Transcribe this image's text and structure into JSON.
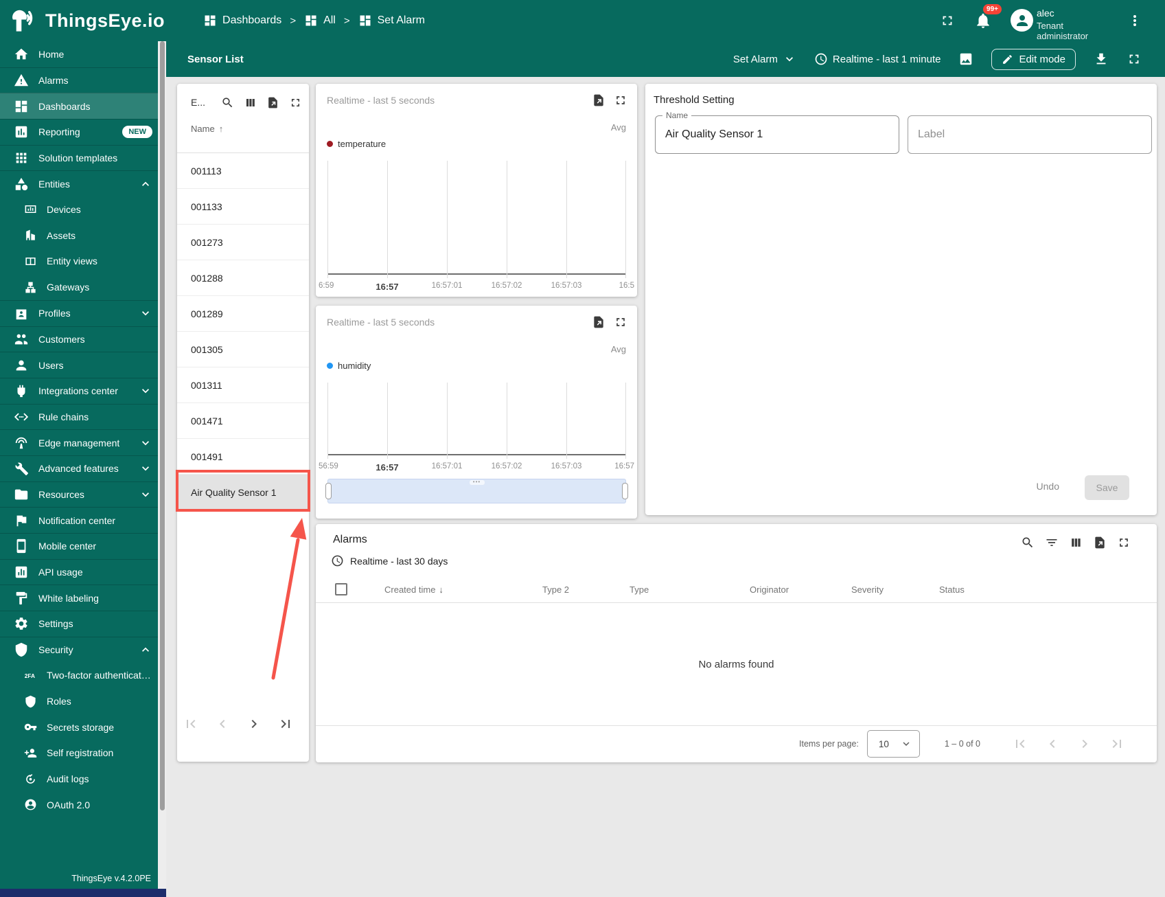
{
  "colors": {
    "brand": "#076a5e",
    "annotation": "#f5554b",
    "temperature_series": "#9e1b23",
    "humidity_series": "#2196f3"
  },
  "topbar": {
    "brand": "ThingsEye.io",
    "breadcrumbs": [
      "Dashboards",
      "All",
      "Set Alarm"
    ],
    "separator": ">",
    "notification_badge": "99+",
    "user": {
      "name": "alec",
      "role": "Tenant administrator"
    }
  },
  "toolbar": {
    "title": "Sensor List",
    "state": "Set Alarm",
    "timewindow": "Realtime - last 1 minute",
    "edit_mode": "Edit mode"
  },
  "sidebar": {
    "items": [
      {
        "label": "Home"
      },
      {
        "label": "Alarms"
      },
      {
        "label": "Dashboards"
      },
      {
        "label": "Reporting",
        "badge": "NEW"
      },
      {
        "label": "Solution templates"
      },
      {
        "label": "Entities"
      },
      {
        "label": "Devices"
      },
      {
        "label": "Assets"
      },
      {
        "label": "Entity views"
      },
      {
        "label": "Gateways"
      },
      {
        "label": "Profiles"
      },
      {
        "label": "Customers"
      },
      {
        "label": "Users"
      },
      {
        "label": "Integrations center"
      },
      {
        "label": "Rule chains"
      },
      {
        "label": "Edge management"
      },
      {
        "label": "Advanced features"
      },
      {
        "label": "Resources"
      },
      {
        "label": "Notification center"
      },
      {
        "label": "Mobile center"
      },
      {
        "label": "API usage"
      },
      {
        "label": "White labeling"
      },
      {
        "label": "Settings"
      },
      {
        "label": "Security"
      },
      {
        "label": "Two-factor authenticati…"
      },
      {
        "label": "Roles"
      },
      {
        "label": "Secrets storage"
      },
      {
        "label": "Self registration"
      },
      {
        "label": "Audit logs"
      },
      {
        "label": "OAuth 2.0"
      }
    ],
    "version": "ThingsEye v.4.2.0PE"
  },
  "entity_list": {
    "title": "E...",
    "name_column": "Name",
    "sort_asc": "↑",
    "rows": [
      "001113",
      "001133",
      "001273",
      "001288",
      "001289",
      "001305",
      "001311",
      "001471",
      "001491"
    ],
    "selected_row": "Air Quality Sensor 1"
  },
  "charts": [
    {
      "timewindow": "Realtime - last 5 seconds",
      "aggregation": "Avg",
      "legend": "temperature",
      "color": "#9e1b23",
      "x_ticks": [
        "6:59",
        "16:57",
        "16:57:01",
        "16:57:02",
        "16:57:03",
        "16:5"
      ],
      "values": []
    },
    {
      "timewindow": "Realtime - last 5 seconds",
      "aggregation": "Avg",
      "legend": "humidity",
      "color": "#2196f3",
      "x_ticks": [
        "56:59",
        "16:57",
        "16:57:01",
        "16:57:02",
        "16:57:03",
        "16:57"
      ],
      "values": []
    }
  ],
  "threshold": {
    "title": "Threshold Setting",
    "fields": [
      {
        "label": "Name",
        "value": "Air Quality Sensor 1"
      },
      {
        "placeholder": "Label"
      }
    ],
    "undo": "Undo",
    "save": "Save"
  },
  "alarms": {
    "title": "Alarms",
    "timewindow": "Realtime - last 30 days",
    "columns": [
      "Created time",
      "Type 2",
      "Type",
      "Originator",
      "Severity",
      "Status"
    ],
    "sort_desc": "↓",
    "empty": "No alarms found",
    "footer": {
      "items_per_page_label": "Items per page:",
      "items_per_page": "10",
      "range": "1 – 0 of 0"
    }
  }
}
